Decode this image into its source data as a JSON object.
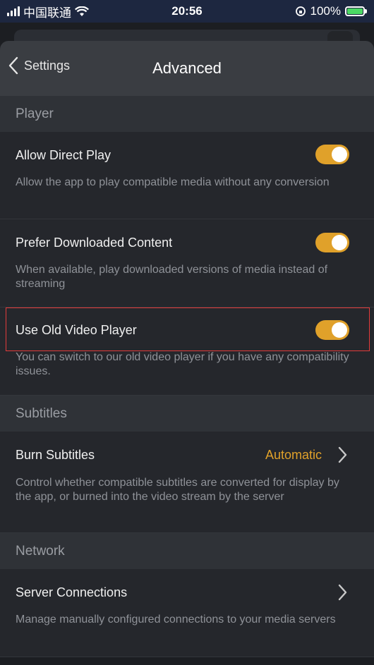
{
  "status_bar": {
    "carrier": "中国联通",
    "time": "20:56",
    "battery": "100%"
  },
  "nav": {
    "back_label": "Settings",
    "title": "Advanced"
  },
  "sections": {
    "player": {
      "header": "Player",
      "allow_direct_play": {
        "title": "Allow Direct Play",
        "description": "Allow the app to play compatible media without any conversion",
        "enabled": true
      },
      "prefer_downloaded": {
        "title": "Prefer Downloaded Content",
        "description": "When available, play downloaded versions of media instead of streaming",
        "enabled": true
      },
      "old_video_player": {
        "title": "Use Old Video Player",
        "description": "You can switch to our old video player if you have any compatibility issues.",
        "enabled": true
      }
    },
    "subtitles": {
      "header": "Subtitles",
      "burn_subtitles": {
        "title": "Burn Subtitles",
        "value": "Automatic",
        "description": "Control whether compatible subtitles are converted for display by the app, or burned into the video stream by the server"
      }
    },
    "network": {
      "header": "Network",
      "server_connections": {
        "title": "Server Connections",
        "description": "Manage manually configured connections to your media servers"
      }
    }
  },
  "colors": {
    "accent": "#e0a12a",
    "highlight_border": "#e23b3b"
  }
}
